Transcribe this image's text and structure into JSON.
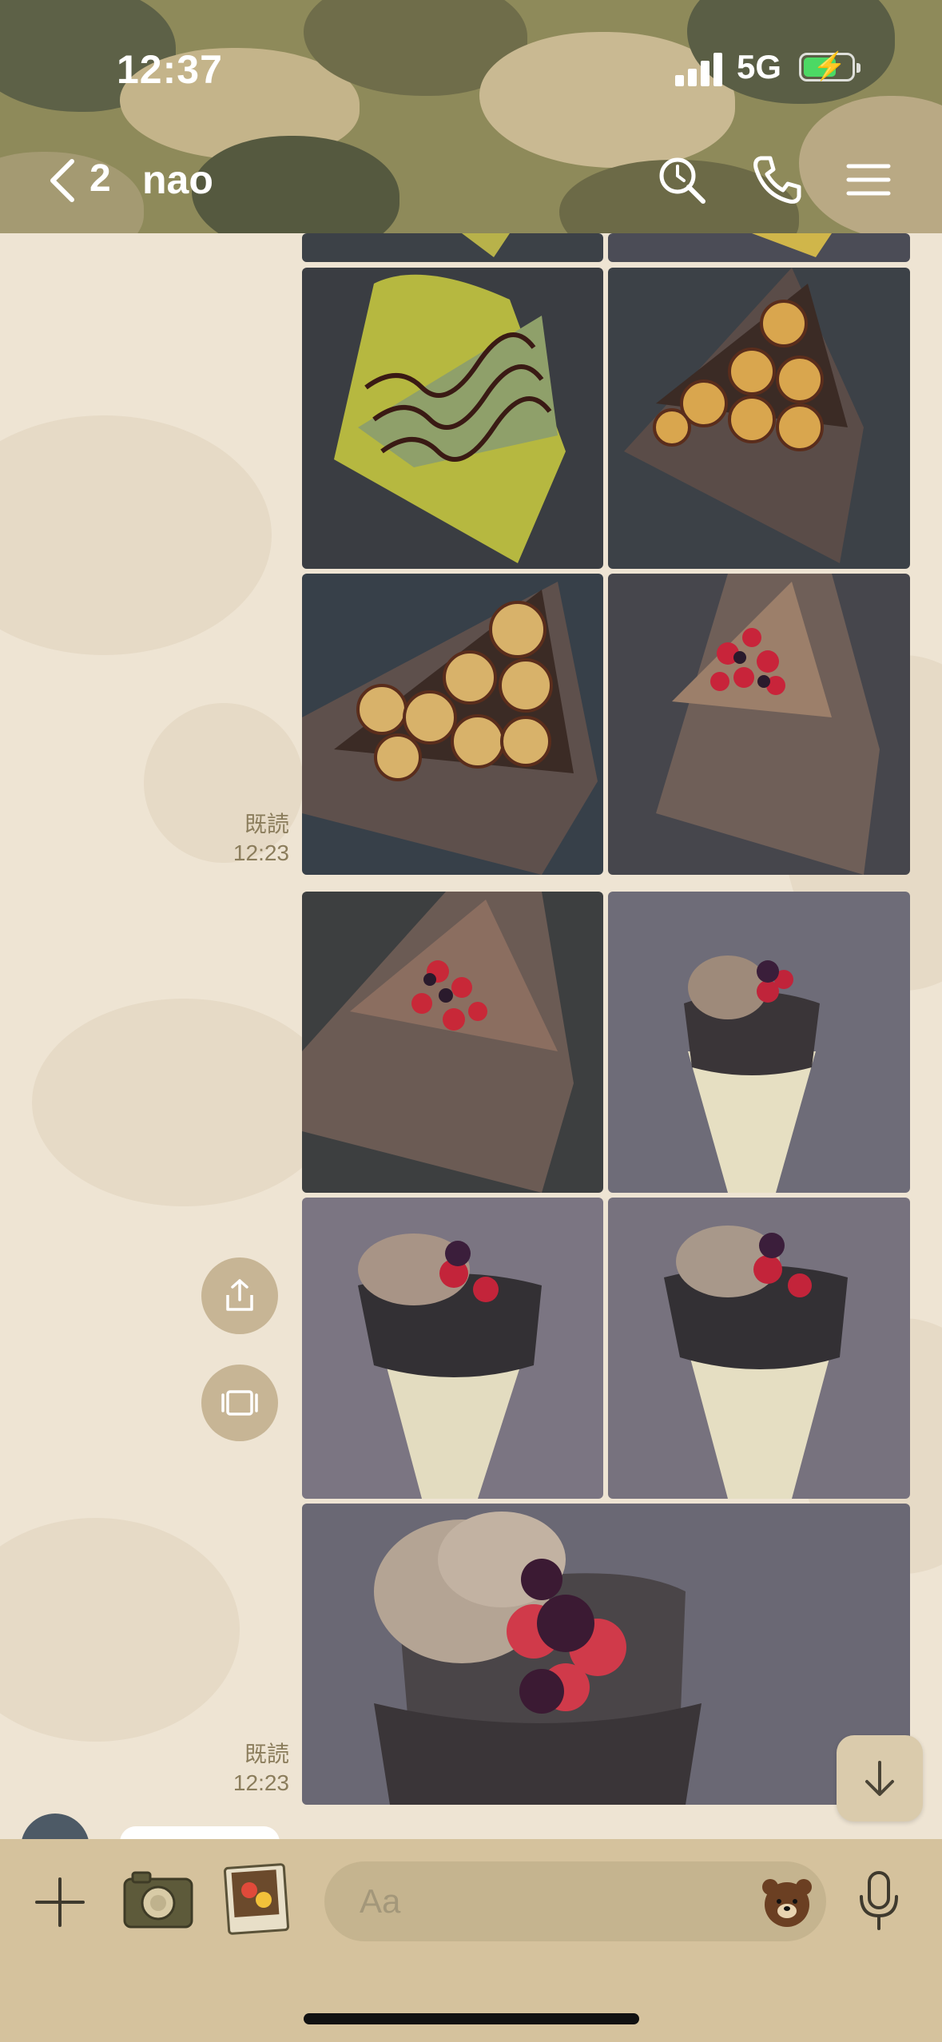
{
  "status_bar": {
    "time": "12:37",
    "network": "5G"
  },
  "header": {
    "back_count": "2",
    "chat_name": "nao"
  },
  "messages": [
    {
      "read": "既読",
      "time": "12:23"
    },
    {
      "read": "既読",
      "time": "12:23"
    }
  ],
  "composer": {
    "placeholder": "Aa"
  },
  "colors": {
    "header_camo_dark": "#5d6147",
    "header_camo_mid": "#8e8a5a",
    "header_camo_light": "#c4b48a",
    "chat_background": "#eee4d3",
    "bottom_bar": "#d5c29d",
    "meta_text": "#8b7d5c"
  },
  "icons": [
    "chevron-left-icon",
    "search-icon",
    "phone-icon",
    "menu-icon",
    "share-icon",
    "gallery-icon",
    "arrow-down-icon",
    "plus-icon",
    "camera-icon",
    "photo-album-icon",
    "bear-sticker-icon",
    "microphone-icon"
  ]
}
